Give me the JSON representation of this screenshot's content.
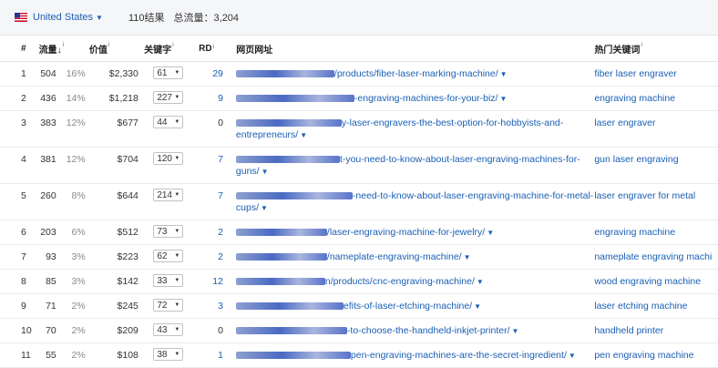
{
  "filter": {
    "country": "United States",
    "results": "110结果",
    "traffic_label": "总流量：3,204"
  },
  "columns": {
    "num": "#",
    "traffic": "流量",
    "value": "价值",
    "keywords": "关键字",
    "rd": "RD",
    "url": "网页网址",
    "top_keyword": "热门关键词"
  },
  "rows": [
    {
      "num": "1",
      "traffic": "504",
      "pct": "16%",
      "value": "$2,330",
      "kw": "61",
      "rd": "29",
      "url_tail": "/products/fiber-laser-marking-machine/",
      "url_tail2": "",
      "blur_w": 108,
      "top_keyword": "fiber laser engraver"
    },
    {
      "num": "2",
      "traffic": "436",
      "pct": "14%",
      "value": "$1,218",
      "kw": "227",
      "rd": "9",
      "url_tail": "-engraving-machines-for-your-biz/",
      "url_tail2": "",
      "blur_w": 130,
      "top_keyword": "engraving machine"
    },
    {
      "num": "3",
      "traffic": "383",
      "pct": "12%",
      "value": "$677",
      "kw": "44",
      "rd": "0",
      "url_tail": "y-laser-engravers-the-best-option-for-hobbyists-and-",
      "url_tail2": "entrepreneurs/",
      "blur_w": 116,
      "top_keyword": "laser engraver"
    },
    {
      "num": "4",
      "traffic": "381",
      "pct": "12%",
      "value": "$704",
      "kw": "120",
      "rd": "7",
      "url_tail": "t-you-need-to-know-about-laser-engraving-machines-for-",
      "url_tail2": "guns/",
      "blur_w": 114,
      "top_keyword": "gun laser engraving"
    },
    {
      "num": "5",
      "traffic": "260",
      "pct": "8%",
      "value": "$644",
      "kw": "214",
      "rd": "7",
      "url_tail": "-need-to-know-about-laser-engraving-machine-for-metal-",
      "url_tail2": "cups/",
      "blur_w": 128,
      "top_keyword": "laser engraver for metal"
    },
    {
      "num": "6",
      "traffic": "203",
      "pct": "6%",
      "value": "$512",
      "kw": "73",
      "rd": "2",
      "url_tail": "/laser-engraving-machine-for-jewelry/",
      "url_tail2": "",
      "blur_w": 100,
      "top_keyword": "engraving machine"
    },
    {
      "num": "7",
      "traffic": "93",
      "pct": "3%",
      "value": "$223",
      "kw": "62",
      "rd": "2",
      "url_tail": "/nameplate-engraving-machine/",
      "url_tail2": "",
      "blur_w": 100,
      "top_keyword": "nameplate engraving machi"
    },
    {
      "num": "8",
      "traffic": "85",
      "pct": "3%",
      "value": "$142",
      "kw": "33",
      "rd": "12",
      "url_tail": "n/products/cnc-engraving-machine/",
      "url_tail2": "",
      "blur_w": 98,
      "top_keyword": "wood engraving machine"
    },
    {
      "num": "9",
      "traffic": "71",
      "pct": "2%",
      "value": "$245",
      "kw": "72",
      "rd": "3",
      "url_tail": "efits-of-laser-etching-machine/",
      "url_tail2": "",
      "blur_w": 118,
      "top_keyword": "laser etching machine"
    },
    {
      "num": "10",
      "traffic": "70",
      "pct": "2%",
      "value": "$209",
      "kw": "43",
      "rd": "0",
      "url_tail": "-to-choose-the-handheld-inkjet-printer/",
      "url_tail2": "",
      "blur_w": 122,
      "top_keyword": "handheld printer"
    },
    {
      "num": "11",
      "traffic": "55",
      "pct": "2%",
      "value": "$108",
      "kw": "38",
      "rd": "1",
      "url_tail": "pen-engraving-machines-are-the-secret-ingredient/",
      "url_tail2": "",
      "blur_w": 126,
      "top_keyword": "pen engraving machine"
    }
  ]
}
